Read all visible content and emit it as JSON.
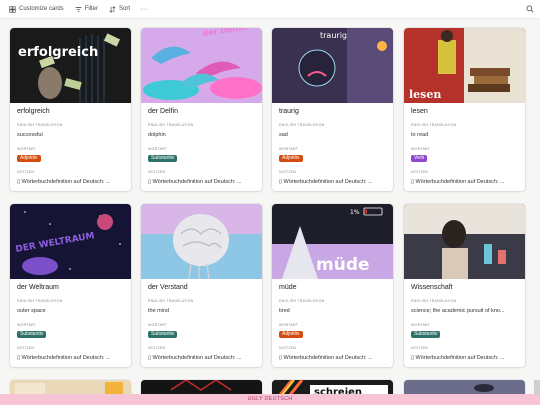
{
  "toolbar": {
    "customize_label": "Customize cards",
    "filter_label": "Filter",
    "sort_label": "Sort",
    "more_label": "···"
  },
  "labels": {
    "translation": "ENGLISH TRANSLATION",
    "wortart": "WORTART",
    "notizen": "NOTIZEN"
  },
  "cards": [
    {
      "title": "erfolgreich",
      "translation": "successful",
      "wortart": "Adjektiv",
      "notes": "▯ Wörterbuchdefinition auf Deutsch: ...",
      "cover_text": "erfolgreich",
      "cover_bg": "#1a1a1a"
    },
    {
      "title": "der Delfin",
      "translation": "dolphin",
      "wortart": "Substantiv",
      "notes": "▯ Wörterbuchdefinition auf Deutsch: ...",
      "cover_text": "der Delfin",
      "cover_bg": "#d6a9ea"
    },
    {
      "title": "traurig",
      "translation": "sad",
      "wortart": "Adjektiv",
      "notes": "▯ Wörterbuchdefinition auf Deutsch: ...",
      "cover_text": "traurig",
      "cover_bg": "#3a3150"
    },
    {
      "title": "lesen",
      "translation": "to read",
      "wortart": "Verb",
      "notes": "▯ Wörterbuchdefinition auf Deutsch: ...",
      "cover_text": "lesen",
      "cover_bg": "#b5322a"
    },
    {
      "title": "der Weltraum",
      "translation": "outer space",
      "wortart": "Substantiv",
      "notes": "▯ Wörterbuchdefinition auf Deutsch: ...",
      "cover_text": "DER WELTRAUM",
      "cover_bg": "#161434"
    },
    {
      "title": "der Verstand",
      "translation": "the mind",
      "wortart": "Substantiv",
      "notes": "▯ Wörterbuchdefinition auf Deutsch: ...",
      "cover_text": "",
      "cover_bg": "#8ec7e6"
    },
    {
      "title": "müde",
      "translation": "tired",
      "wortart": "Adjektiv",
      "notes": "▯ Wörterbuchdefinition auf Deutsch: ...",
      "cover_text": "müde",
      "cover_bg": "#1e1e2a",
      "battery_text": "1%"
    },
    {
      "title": "Wissenschaft",
      "translation": "science; the academic pursuit of kno...",
      "wortart": "Substantiv",
      "notes": "▯ Wörterbuchdefinition auf Deutsch: ...",
      "cover_text": "",
      "cover_bg": "#3b3b47"
    }
  ],
  "partial_row": [
    {
      "cover_bg": "#e9d9b8"
    },
    {
      "cover_bg": "#141414"
    },
    {
      "cover_bg": "#1b1b1b",
      "cover_text": "schreien"
    },
    {
      "cover_bg": "#6c6d8a"
    }
  ],
  "footer_text": "UGLY DEUTSCH",
  "colors": {
    "adjektiv": "#d44c10",
    "substantiv": "#2e7169",
    "verb": "#8f47d1",
    "footer_bg": "#f7c4d6"
  }
}
